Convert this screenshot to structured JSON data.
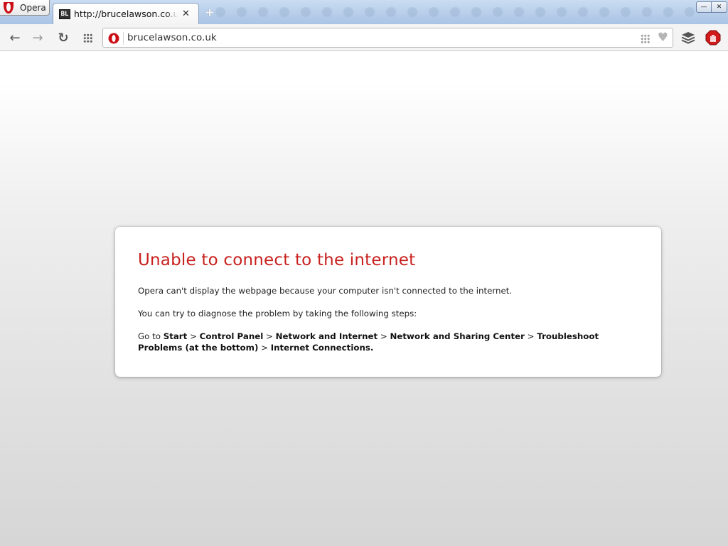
{
  "browser": {
    "menu_label": "Opera",
    "colors": {
      "brand_red": "#cc0f16",
      "error_red": "#c8211e"
    }
  },
  "tabs": [
    {
      "title": "http://brucelawson.co.uk/",
      "favicon_text": "BL",
      "close_glyph": "✕",
      "active": true
    }
  ],
  "newtab_glyph": "+",
  "window_controls": {
    "minimize": "—",
    "close": "✕"
  },
  "toolbar": {
    "back_glyph": "←",
    "forward_glyph": "→",
    "reload_glyph": "↻",
    "icons": [
      "back-arrow-icon",
      "forward-arrow-icon",
      "reload-icon",
      "speed-dial-grid-icon",
      "stash-icon",
      "adblock-icon"
    ]
  },
  "address_bar": {
    "value": "brucelawson.co.uk",
    "badge_icon": "opera-o-icon",
    "heart_glyph": "♥"
  },
  "error": {
    "title": "Unable to connect to the internet",
    "description": "Opera can't display the webpage because your computer isn't connected to the internet.",
    "steps_intro": "You can try to diagnose the problem by taking the following steps:",
    "steps_prefix": "Go to ",
    "path": [
      "Start",
      "Control Panel",
      "Network and Internet",
      "Network and Sharing Center",
      "Troubleshoot Problems (at the bottom)",
      "Internet Connections."
    ],
    "separator": " > "
  }
}
